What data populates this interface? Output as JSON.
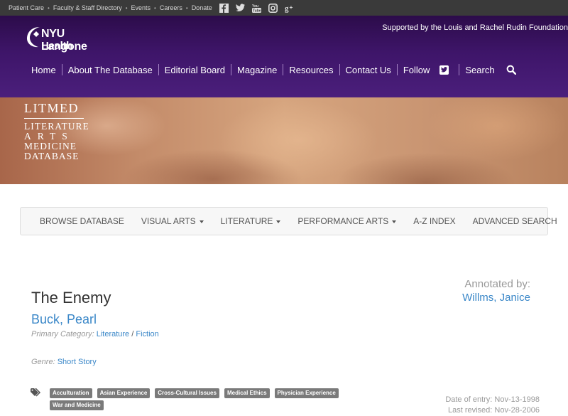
{
  "topbar": {
    "links": [
      "Patient Care",
      "Faculty & Staff Directory",
      "Events",
      "Careers",
      "Donate"
    ],
    "social_icons": [
      "facebook-icon",
      "twitter-icon",
      "youtube-icon",
      "instagram-icon",
      "google-plus-icon"
    ]
  },
  "header": {
    "logo_line1": "NYU Langone",
    "logo_line2": "Health",
    "supported_by": "Supported by the Louis and Rachel Rudin Foundation",
    "nav": [
      "Home",
      "About The Database",
      "Editorial Board",
      "Magazine",
      "Resources",
      "Contact Us",
      "Follow",
      "Search"
    ]
  },
  "banner": {
    "line1": "LITMED",
    "line2": "LITERATURE",
    "line3": "ARTS",
    "line4": "MEDICINE",
    "line5": "DATABASE"
  },
  "subnav": {
    "items": [
      "BROWSE DATABASE",
      "VISUAL ARTS",
      "LITERATURE",
      "PERFORMANCE ARTS",
      "A-Z INDEX",
      "ADVANCED SEARCH"
    ]
  },
  "entry": {
    "title": "The Enemy",
    "author": "Buck, Pearl",
    "primary_category_label": "Primary Category:",
    "category": "Literature",
    "category_sep": "/",
    "subcategory": "Fiction",
    "genre_label": "Genre:",
    "genre": "Short Story",
    "annotated_by_label": "Annotated by:",
    "annotator": "Willms, Janice",
    "tags": [
      "Acculturation",
      "Asian Experience",
      "Cross-Cultural Issues",
      "Medical Ethics",
      "Physician Experience",
      "War and Medicine"
    ],
    "date_of_entry": "Date of entry: Nov-13-1998",
    "last_revised": "Last revised: Nov-28-2006"
  },
  "colors": {
    "header_purple": "#3e1569",
    "link_blue": "#3a87c8",
    "tag_gray": "#7a7a7a"
  }
}
